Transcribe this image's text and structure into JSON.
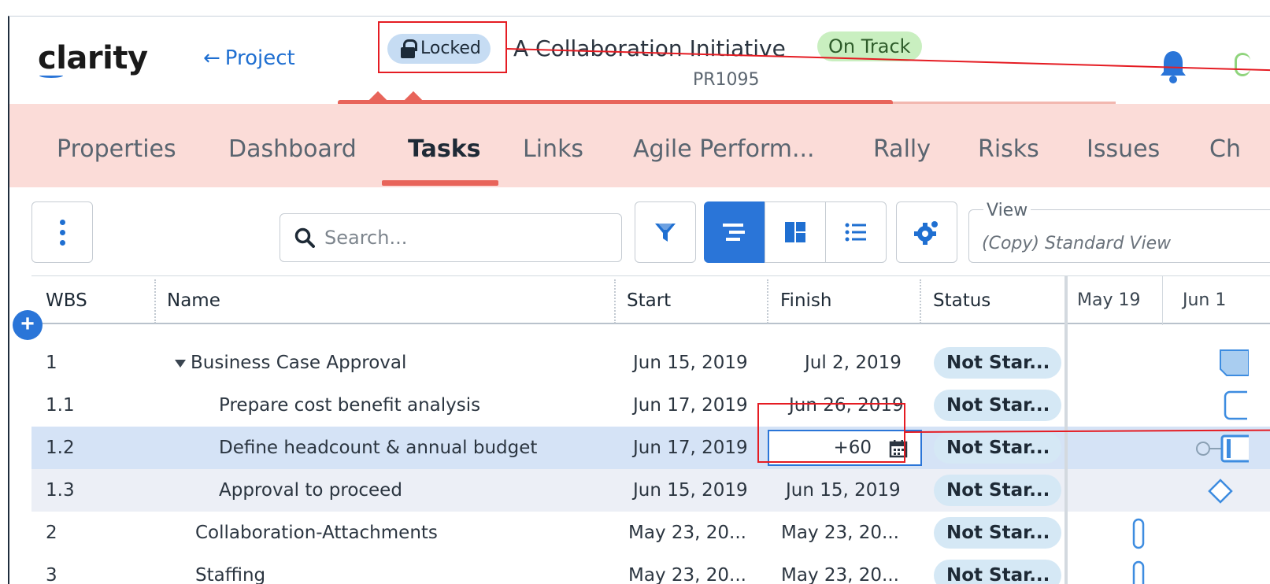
{
  "app": {
    "logo": "clarity",
    "back_link": "Project",
    "back_arrow": "←"
  },
  "project": {
    "locked_label": "Locked",
    "title": "A Collaboration Initiative",
    "code": "PR1095",
    "status": "On Track"
  },
  "tabs": [
    "Properties",
    "Dashboard",
    "Tasks",
    "Links",
    "Agile Perform...",
    "Rally",
    "Risks",
    "Issues",
    "Ch"
  ],
  "active_tab": "Tasks",
  "toolbar": {
    "search_placeholder": "Search...",
    "view_label": "View",
    "view_value": "(Copy) Standard View"
  },
  "grid": {
    "columns": [
      "WBS",
      "Name",
      "Start",
      "Finish",
      "Status"
    ],
    "gantt_columns": [
      "May 19",
      "Jun 1"
    ],
    "rows": [
      {
        "wbs": "1",
        "name": "Business Case Approval",
        "start": "Jun 15, 2019",
        "finish": "Jul 2, 2019",
        "status": "Not Star..."
      },
      {
        "wbs": "1.1",
        "name": "Prepare cost benefit analysis",
        "start": "Jun 17, 2019",
        "finish": "Jun 26, 2019",
        "status": "Not Star..."
      },
      {
        "wbs": "1.2",
        "name": "Define headcount & annual budget",
        "start": "Jun 17, 2019",
        "finish": "+60",
        "status": "Not Star..."
      },
      {
        "wbs": "1.3",
        "name": "Approval to proceed",
        "start": "Jun 15, 2019",
        "finish": "Jun 15, 2019",
        "status": "Not Star..."
      },
      {
        "wbs": "2",
        "name": "Collaboration-Attachments",
        "start": "May 23, 20...",
        "finish": "May 23, 20...",
        "status": "Not Star..."
      },
      {
        "wbs": "3",
        "name": "Staffing",
        "start": "May 23, 20...",
        "finish": "May 23, 20...",
        "status": "Not Star..."
      }
    ]
  },
  "colors": {
    "accent": "#2a75d8",
    "tab_band": "#fbdcd8",
    "progress": "#e8645a",
    "annotation": "#e51c23",
    "on_track": "#c9efc0"
  }
}
